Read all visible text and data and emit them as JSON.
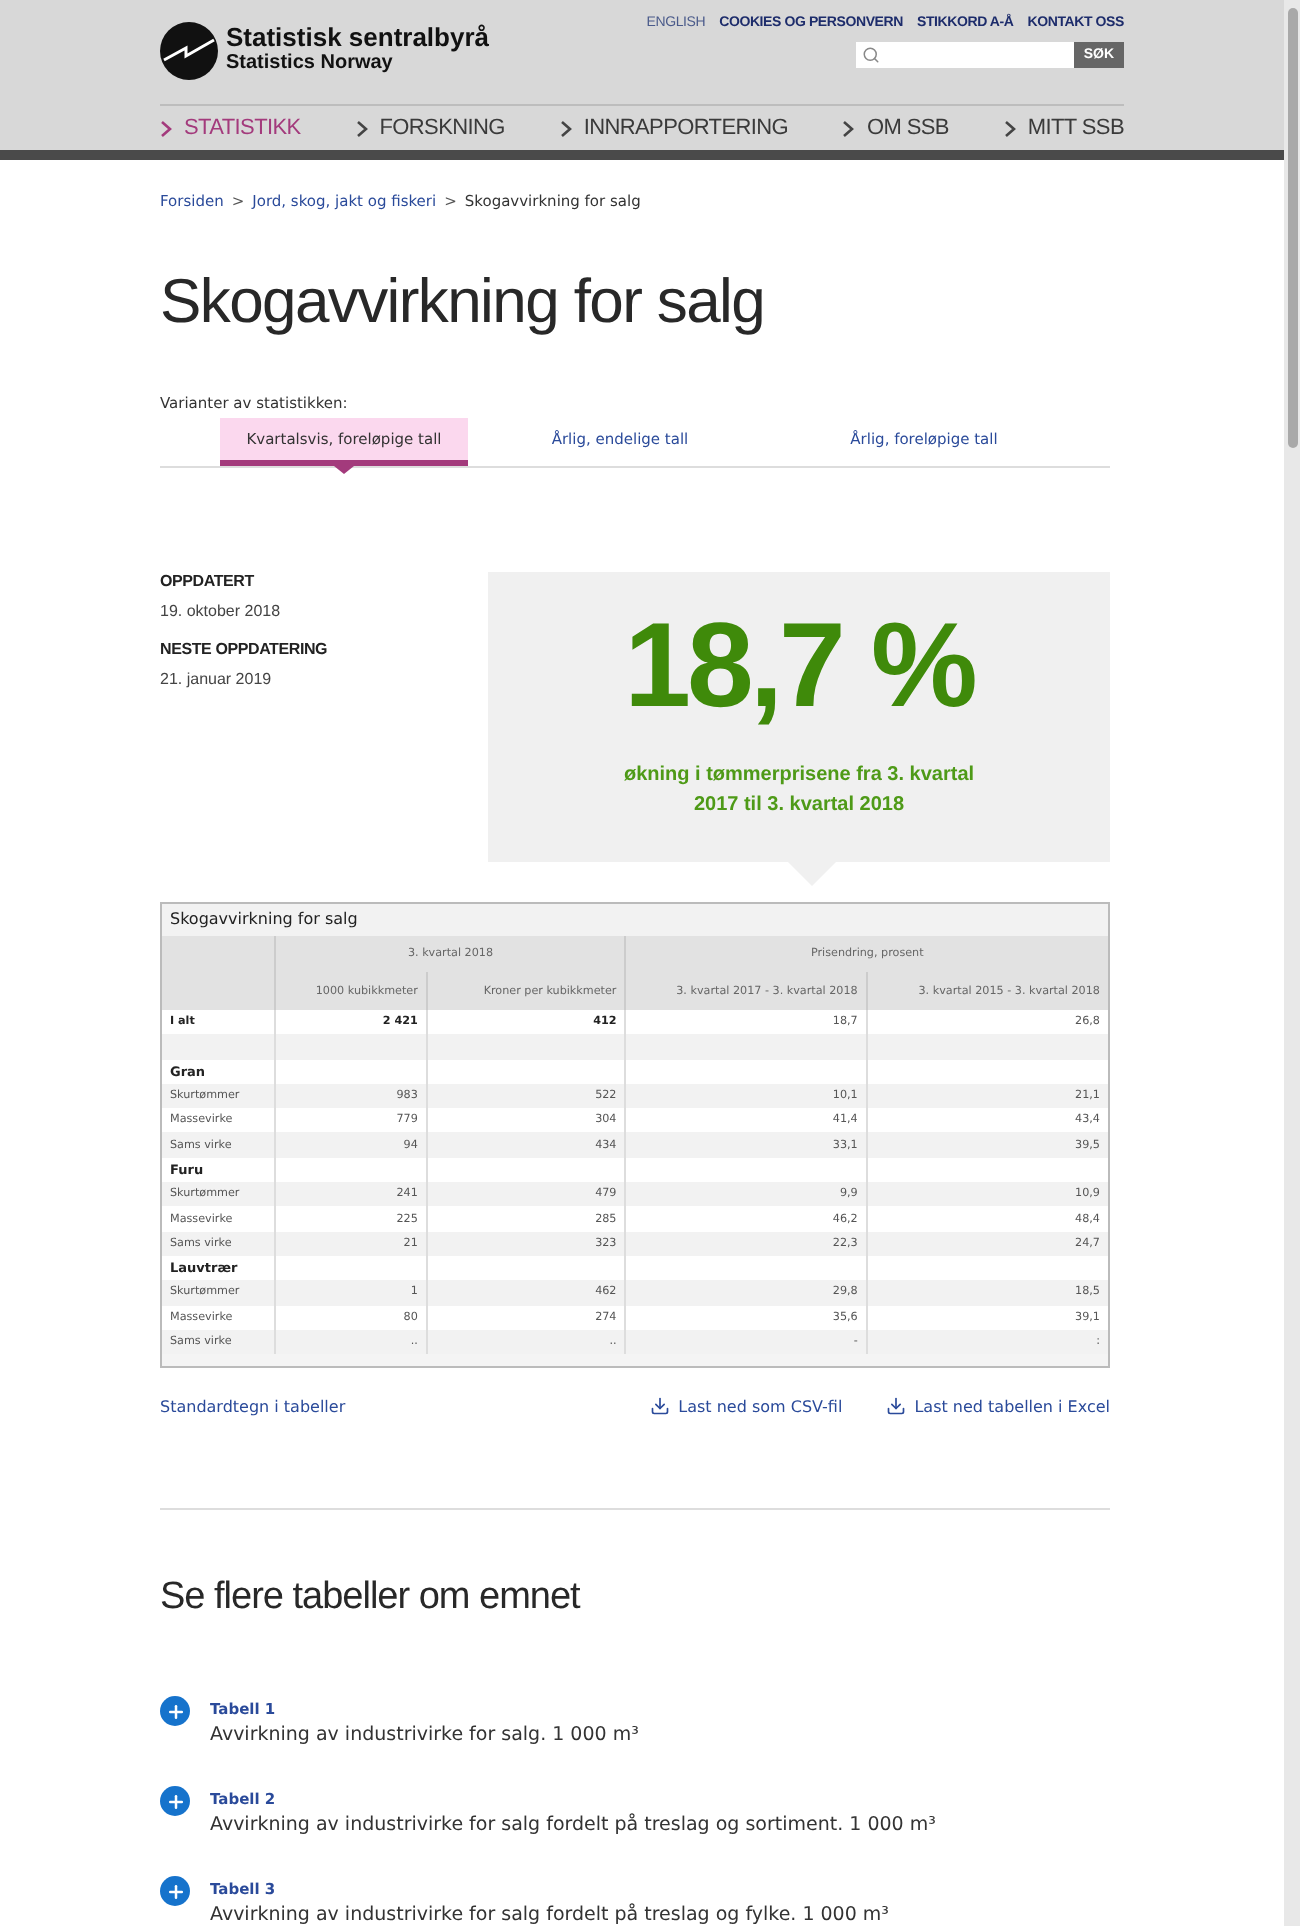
{
  "header": {
    "logo": {
      "name": "Statistisk sentralbyrå",
      "subtitle": "Statistics Norway"
    },
    "top_links": [
      {
        "label": "ENGLISH",
        "kind": "language"
      },
      {
        "label": "COOKIES OG PERSONVERN",
        "kind": "link"
      },
      {
        "label": "STIKKORD A-Å",
        "kind": "link"
      },
      {
        "label": "KONTAKT OSS",
        "kind": "link"
      }
    ],
    "search": {
      "button": "SØK"
    },
    "nav": [
      {
        "label": "STATISTIKK",
        "selected": true
      },
      {
        "label": "FORSKNING",
        "selected": false
      },
      {
        "label": "INNRAPPORTERING",
        "selected": false
      },
      {
        "label": "OM SSB",
        "selected": false
      },
      {
        "label": "MITT SSB",
        "selected": false
      }
    ]
  },
  "breadcrumb": {
    "separator": ">",
    "items": [
      {
        "label": "Forsiden",
        "kind": "link"
      },
      {
        "label": "Jord, skog, jakt og fiskeri",
        "kind": "link"
      },
      {
        "label": "Skogavvirkning for salg",
        "kind": "current"
      }
    ]
  },
  "title": "Skogavvirkning for salg",
  "variants": {
    "label": "Varianter av statistikken:",
    "tabs": [
      {
        "label": "Kvartalsvis, foreløpige tall",
        "selected": true
      },
      {
        "label": "Årlig, endelige tall",
        "selected": false
      },
      {
        "label": "Årlig, foreløpige tall",
        "selected": false
      }
    ]
  },
  "dates": [
    {
      "label": "OPPDATERT",
      "value": "19. oktober 2018"
    },
    {
      "label": "NESTE OPPDATERING",
      "value": "21. januar 2019"
    }
  ],
  "highlight": {
    "value": "18,7 %",
    "text": "økning i tømmerprisene fra 3. kvartal 2017 til 3. kvartal 2018"
  },
  "table": {
    "caption": "Skogavvirkning for salg",
    "group_headers": [
      "3. kvartal 2018",
      "Prisendring, prosent"
    ],
    "columns": [
      "1000 kubikkmeter",
      "Kroner per kubikkmeter",
      "3. kvartal 2017 - 3. kvartal 2018",
      "3. kvartal 2015 - 3. kvartal 2018"
    ],
    "rows": [
      {
        "kind": "total",
        "label": "I alt",
        "cells": [
          "2 421",
          "412",
          "18,7",
          "26,8"
        ]
      },
      {
        "kind": "blank"
      },
      {
        "kind": "group",
        "label": "Gran"
      },
      {
        "kind": "data",
        "label": "Skurtømmer",
        "cells": [
          "983",
          "522",
          "10,1",
          "21,1"
        ]
      },
      {
        "kind": "data",
        "label": "Massevirke",
        "cells": [
          "779",
          "304",
          "41,4",
          "43,4"
        ]
      },
      {
        "kind": "data",
        "label": "Sams virke",
        "cells": [
          "94",
          "434",
          "33,1",
          "39,5"
        ]
      },
      {
        "kind": "group",
        "label": "Furu"
      },
      {
        "kind": "data",
        "label": "Skurtømmer",
        "cells": [
          "241",
          "479",
          "9,9",
          "10,9"
        ]
      },
      {
        "kind": "data",
        "label": "Massevirke",
        "cells": [
          "225",
          "285",
          "46,2",
          "48,4"
        ]
      },
      {
        "kind": "data",
        "label": "Sams virke",
        "cells": [
          "21",
          "323",
          "22,3",
          "24,7"
        ]
      },
      {
        "kind": "group",
        "label": "Lauvtrær"
      },
      {
        "kind": "data",
        "label": "Skurtømmer",
        "cells": [
          "1",
          "462",
          "29,8",
          "18,5"
        ]
      },
      {
        "kind": "data",
        "label": "Massevirke",
        "cells": [
          "80",
          "274",
          "35,6",
          "39,1"
        ]
      },
      {
        "kind": "data",
        "label": "Sams virke",
        "cells": [
          "..",
          "..",
          "-",
          ":"
        ]
      }
    ]
  },
  "table_links": {
    "symbols": "Standardtegn i tabeller",
    "downloads": [
      "Last ned som CSV-fil",
      "Last ned tabellen i Excel"
    ]
  },
  "more_tables": {
    "heading": "Se flere tabeller om emnet",
    "items": [
      {
        "label": "Tabell 1",
        "title": "Avvirkning av industrivirke for salg. 1 000 m³"
      },
      {
        "label": "Tabell 2",
        "title": "Avvirkning av industrivirke for salg fordelt på treslag og sortiment. 1 000 m³"
      },
      {
        "label": "Tabell 3",
        "title": "Avvirkning av industrivirke for salg fordelt på treslag og fylke. 1 000 m³"
      }
    ]
  }
}
